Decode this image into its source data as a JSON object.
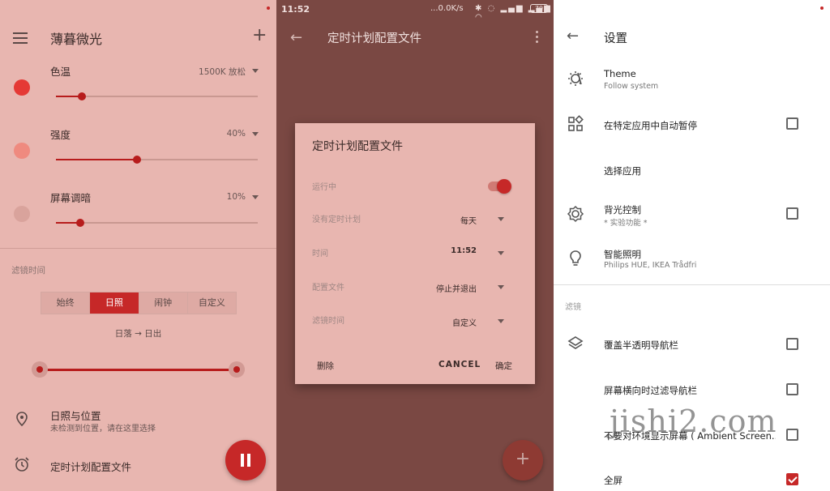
{
  "panel1": {
    "title": "薄暮微光",
    "sliders": [
      {
        "label": "色温",
        "value": "1500K 放松",
        "fraction": 0.13,
        "color": "#e53935"
      },
      {
        "label": "强度",
        "value": "40%",
        "fraction": 0.4,
        "color": "#ef8a7f"
      },
      {
        "label": "屏幕调暗",
        "value": "10%",
        "fraction": 0.12,
        "color": "#d9a39c"
      }
    ],
    "section_label": "滤镜时间",
    "modes": [
      "始终",
      "日照",
      "闹钟",
      "自定义"
    ],
    "active_mode": "日照",
    "range_text": "日落 → 日出",
    "location_title": "日照与位置",
    "location_sub": "未检测到位置，请在这里选择",
    "schedule_label": "定时计划配置文件"
  },
  "panel2": {
    "status": {
      "time": "11:52",
      "net": "...0.0K/s",
      "battery": "79"
    },
    "title": "定时计划配置文件",
    "dialog": {
      "title": "定时计划配置文件",
      "running_label": "运行中",
      "running_on": true,
      "rows": [
        {
          "label": "没有定时计划",
          "value": "每天"
        },
        {
          "label": "时间",
          "value": "11:52"
        },
        {
          "label": "配置文件",
          "value": "停止并退出"
        },
        {
          "label": "滤镜时间",
          "value": "自定义"
        }
      ],
      "delete_label": "删除",
      "cancel_label": "CANCEL",
      "ok_label": "确定"
    }
  },
  "panel3": {
    "title": "设置",
    "items": [
      {
        "title": "Theme",
        "sub": "Follow system",
        "checkbox": null
      },
      {
        "title": "在特定应用中自动暂停",
        "sub": "",
        "checkbox": false
      },
      {
        "title": "选择应用",
        "sub": "",
        "checkbox": null
      },
      {
        "title": "背光控制",
        "sub": "* 实验功能 *",
        "checkbox": false
      },
      {
        "title": "智能照明",
        "sub": "Philips HUE, IKEA Trådfri",
        "checkbox": null
      }
    ],
    "section_label": "滤镜",
    "filter_items": [
      {
        "title": "覆盖半透明导航栏",
        "checkbox": false
      },
      {
        "title": "屏幕横向时过滤导航栏",
        "checkbox": false
      },
      {
        "title": "不要对环境显示屏幕 ( Ambient Screen..",
        "checkbox": false
      },
      {
        "title": "全屏",
        "checkbox": true
      }
    ]
  },
  "watermark": "jishi2.com",
  "colors": {
    "accent": "#c62828",
    "panel_bg": "#e8b6b0",
    "dim_bg": "#7a4843"
  }
}
